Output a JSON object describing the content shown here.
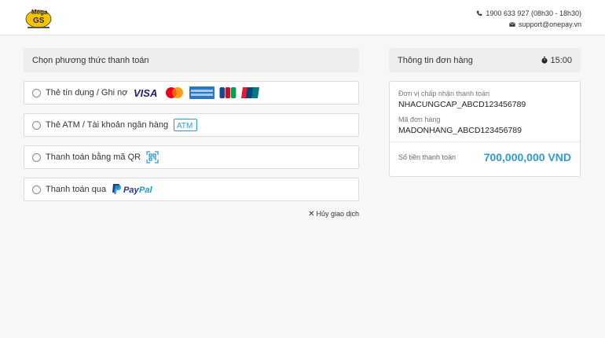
{
  "header": {
    "logo_text": "MegaGS",
    "phone": "1900 633 927 (08h30 - 18h30)",
    "email": "support@onepay.vn"
  },
  "payment": {
    "section_title": "Chọn phương thức thanh toán",
    "options": [
      {
        "label": "Thẻ tín dụng / Ghi nợ",
        "brands": [
          "VISA",
          "Mastercard",
          "American Express",
          "JCB",
          "UnionPay"
        ]
      },
      {
        "label": "Thẻ ATM / Tài khoản ngân hàng",
        "badge": "ATM"
      },
      {
        "label": "Thanh toán bằng mã QR",
        "icon": "qr-scan-icon"
      },
      {
        "label": "Thanh toán qua",
        "brand": "PayPal",
        "brand_pay": "Pay",
        "brand_pal": "Pal"
      }
    ],
    "cancel_label": "Hủy giao dịch",
    "visa_text": "VISA",
    "atm_text": "ATM"
  },
  "order": {
    "title": "Thông tin đơn hàng",
    "timer": "15:00",
    "merchant_label": "Đơn vị chấp nhận thanh toán",
    "merchant_value": "NHACUNGCAP_ABCD123456789",
    "order_label": "Mã đơn hàng",
    "order_value": "MADONHANG_ABCD123456789",
    "amount_label": "Số tiền thanh toán",
    "amount_value": "700,000,000 VND"
  },
  "colors": {
    "accent": "#2e9ad6",
    "paypal_dark": "#253b80",
    "paypal_light": "#179bd7",
    "visa_blue": "#1a1f71"
  }
}
